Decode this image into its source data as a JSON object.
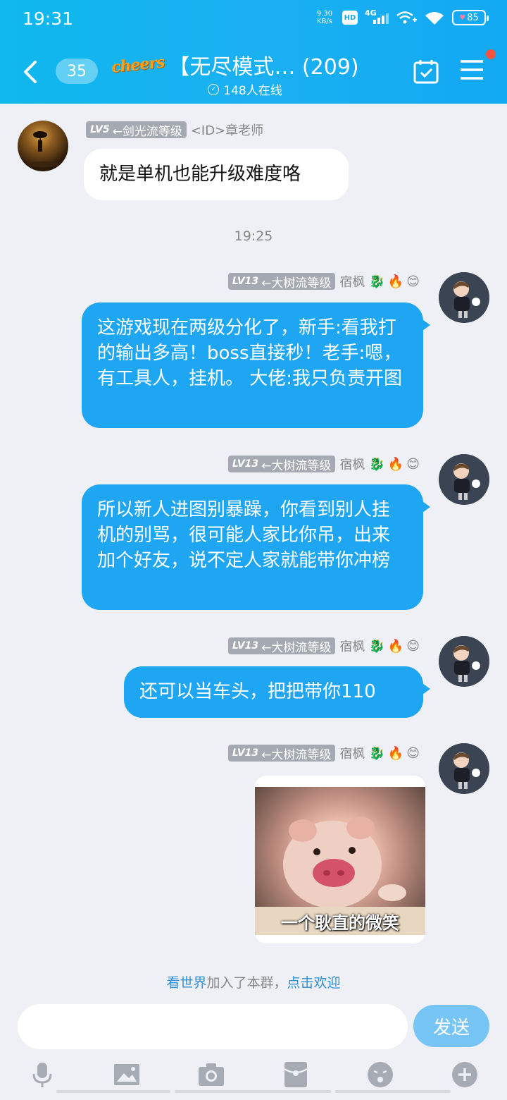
{
  "status_bar": {
    "time": "19:31",
    "net_speed_value": "9.30",
    "net_speed_unit": "KB/s",
    "hd_label": "HD",
    "network_label": "4G",
    "battery_level": "85"
  },
  "nav": {
    "unread_count": "35",
    "logo_text": "cheers",
    "group_title": "【无尽模式… (209)",
    "online_text": "148人在线"
  },
  "messages": [
    {
      "side": "left",
      "level": "LV5",
      "title": "←剑光流等级",
      "sender": "<ID>章老师",
      "text": "就是单机也能升级难度咯"
    },
    {
      "side": "right",
      "level": "LV13",
      "title": "←大树流等级",
      "sender": "宿枫",
      "text": "这游戏现在两级分化了，新手:看我打的输出多高！boss直接秒！老手:嗯，有工具人，挂机。 大佬:我只负责开图"
    },
    {
      "side": "right",
      "level": "LV13",
      "title": "←大树流等级",
      "sender": "宿枫",
      "text": "所以新人进图别暴躁，你看到别人挂机的别骂，很可能人家比你吊，出来加个好友，说不定人家就能带你冲榜"
    },
    {
      "side": "right",
      "level": "LV13",
      "title": "←大树流等级",
      "sender": "宿枫",
      "text": "还可以当车头，把把带你110"
    },
    {
      "side": "right",
      "level": "LV13",
      "title": "←大树流等级",
      "sender": "宿枫",
      "sticker_caption": "一个耿直的微笑"
    }
  ],
  "time_separator": "19:25",
  "join_notice": {
    "user": "看世界",
    "middle": "加入了本群，",
    "action": "点击欢迎"
  },
  "input": {
    "placeholder": "",
    "send_label": "发送"
  },
  "colors": {
    "header": "#16aff0",
    "bubble_right": "#1ea6f3",
    "send_button": "#77c5f4"
  }
}
